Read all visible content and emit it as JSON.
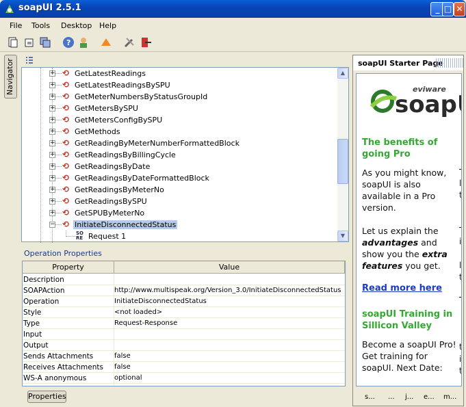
{
  "window": {
    "title": "soapUI 2.5.1",
    "minimize": "_",
    "maximize": "□",
    "close": "✕"
  },
  "menu": [
    "File",
    "Tools",
    "Desktop",
    "Help"
  ],
  "navigator_tab": "Navigator",
  "tree": [
    {
      "label": "GetLatestReadings"
    },
    {
      "label": "GetLatestReadingsBySPU"
    },
    {
      "label": "GetMeterNumbersByStatusGroupId"
    },
    {
      "label": "GetMetersBySPU"
    },
    {
      "label": "GetMetersConfigBySPU"
    },
    {
      "label": "GetMethods"
    },
    {
      "label": "GetReadingByMeterNumberFormattedBlock"
    },
    {
      "label": "GetReadingsByBillingCycle"
    },
    {
      "label": "GetReadingsByDate"
    },
    {
      "label": "GetReadingsByDateFormattedBlock"
    },
    {
      "label": "GetReadingsByMeterNo"
    },
    {
      "label": "GetReadingsBySPU"
    },
    {
      "label": "GetSPUByMeterNo"
    },
    {
      "label": "InitiateDisconnectedStatus"
    },
    {
      "label": "Request 1"
    }
  ],
  "props": {
    "title": "Operation Properties",
    "col_property": "Property",
    "col_value": "Value",
    "rows": [
      {
        "name": "Description",
        "value": ""
      },
      {
        "name": "SOAPAction",
        "value": "http://www.multispeak.org/Version_3.0/InitiateDisconnectedStatus"
      },
      {
        "name": "Operation",
        "value": "InitiateDisconnectedStatus"
      },
      {
        "name": "Style",
        "value": "<not loaded>"
      },
      {
        "name": "Type",
        "value": "Request-Response"
      },
      {
        "name": "Input",
        "value": ""
      },
      {
        "name": "Output",
        "value": ""
      },
      {
        "name": "Sends Attachments",
        "value": "false"
      },
      {
        "name": "Receives Attachments",
        "value": "false"
      },
      {
        "name": "WS-A anonymous",
        "value": "optional"
      }
    ]
  },
  "bottom_tab": "Properties",
  "starter": {
    "title": "soapUI Starter Page",
    "logo_brand": "eviware",
    "logo_product": "soapU",
    "h1": "The benefits of going Pro",
    "p1": "As you might know, soapUI is also available in a Pro version.",
    "p2a": "Let us explain the",
    "p2b": "advantages",
    "p2c": "and show you the",
    "p2d": "extra features",
    "p2e": "you get.",
    "link": "Read more here",
    "h2": "soapUI Training in Sillicon Valley",
    "p3": "Become a soapUI Pro! Get training for soapUI. Next Date:",
    "right_fragments": [
      "T",
      "l",
      "t",
      "T",
      "i",
      "l",
      "t",
      "T",
      "t",
      "i",
      "t"
    ],
    "bottom": [
      "s...",
      "...",
      "j...",
      "e...",
      "m..."
    ]
  }
}
